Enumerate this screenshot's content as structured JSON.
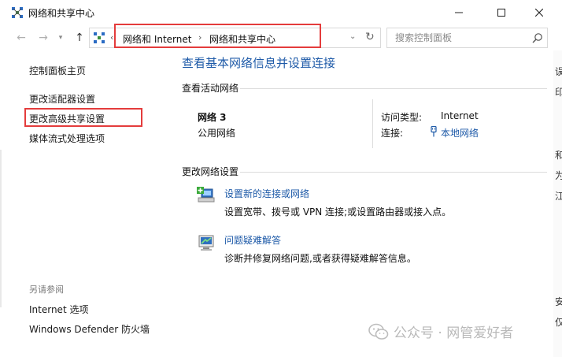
{
  "window": {
    "title": "网络和共享中心"
  },
  "address_bar": {
    "breadcrumbs": [
      "网络和 Internet",
      "网络和共享中心"
    ],
    "separator": "›"
  },
  "search": {
    "placeholder": "搜索控制面板"
  },
  "left_pane": {
    "home": "控制面板主页",
    "links": [
      "更改适配器设置",
      "更改高级共享设置",
      "媒体流式处理选项"
    ],
    "see_also_title": "另请参阅",
    "see_also": [
      "Internet 选项",
      "Windows Defender 防火墙"
    ]
  },
  "main": {
    "title": "查看基本网络信息并设置连接",
    "active_networks_heading": "查看活动网络",
    "network": {
      "name": "网络 3",
      "category": "公用网络",
      "access_type_label": "访问类型:",
      "access_type_value": "Internet",
      "connections_label": "连接:",
      "connection_link": "本地网络"
    },
    "change_settings_heading": "更改网络设置",
    "tasks": [
      {
        "link": "设置新的连接或网络",
        "description": "设置宽带、拨号或 VPN 连接;或设置路由器或接入点。",
        "icon": "new-connection-icon"
      },
      {
        "link": "问题疑难解答",
        "description": "诊断并修复网络问题,或者获得疑难解答信息。",
        "icon": "troubleshoot-icon"
      }
    ]
  },
  "watermark": {
    "text": "公众号 · 网管爱好者"
  },
  "edge_fragment": [
    "误",
    "印",
    "和",
    "为",
    "江",
    "安",
    "仅"
  ],
  "colors": {
    "link": "#1e5aa8",
    "highlight": "#e43c3c"
  }
}
